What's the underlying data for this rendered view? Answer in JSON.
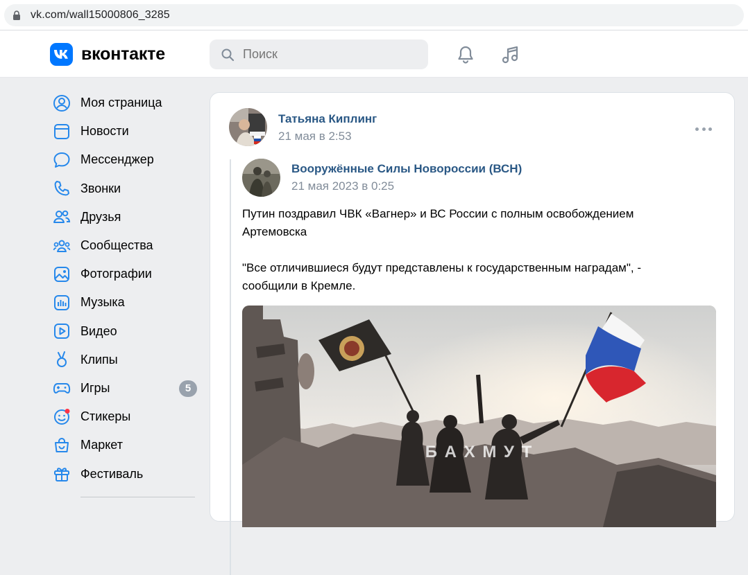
{
  "browser": {
    "url": "vk.com/wall15000806_3285"
  },
  "header": {
    "logo_text": "вконтакте",
    "search_placeholder": "Поиск",
    "brand_color": "#0077ff"
  },
  "sidebar": {
    "items": [
      {
        "label": "Моя страница",
        "icon": "user-circle-icon"
      },
      {
        "label": "Новости",
        "icon": "newspaper-icon"
      },
      {
        "label": "Мессенджер",
        "icon": "chat-bubble-icon"
      },
      {
        "label": "Звонки",
        "icon": "phone-icon"
      },
      {
        "label": "Друзья",
        "icon": "friends-icon"
      },
      {
        "label": "Сообщества",
        "icon": "communities-icon"
      },
      {
        "label": "Фотографии",
        "icon": "photo-icon"
      },
      {
        "label": "Музыка",
        "icon": "music-bars-icon"
      },
      {
        "label": "Видео",
        "icon": "video-icon"
      },
      {
        "label": "Клипы",
        "icon": "clips-icon"
      },
      {
        "label": "Игры",
        "icon": "gamepad-icon",
        "badge": "5"
      },
      {
        "label": "Стикеры",
        "icon": "sticker-icon"
      },
      {
        "label": "Маркет",
        "icon": "market-bag-icon"
      },
      {
        "label": "Фестиваль",
        "icon": "gift-icon"
      }
    ]
  },
  "post": {
    "author": "Татьяна Киплинг",
    "date": "21 мая в 2:53",
    "repost": {
      "author": "Вооружённые Силы Новороссии (ВСН)",
      "date": "21 мая 2023 в 0:25",
      "text_paragraph_1": "Путин поздравил ЧВК «Вагнер» и ВС России с полным освобождением Артемовска",
      "text_paragraph_2": "\"Все отличившиеся будут представлены к государственным наградам\", - сообщили в Кремле.",
      "image_caption": "Б А Х М У Т"
    }
  }
}
